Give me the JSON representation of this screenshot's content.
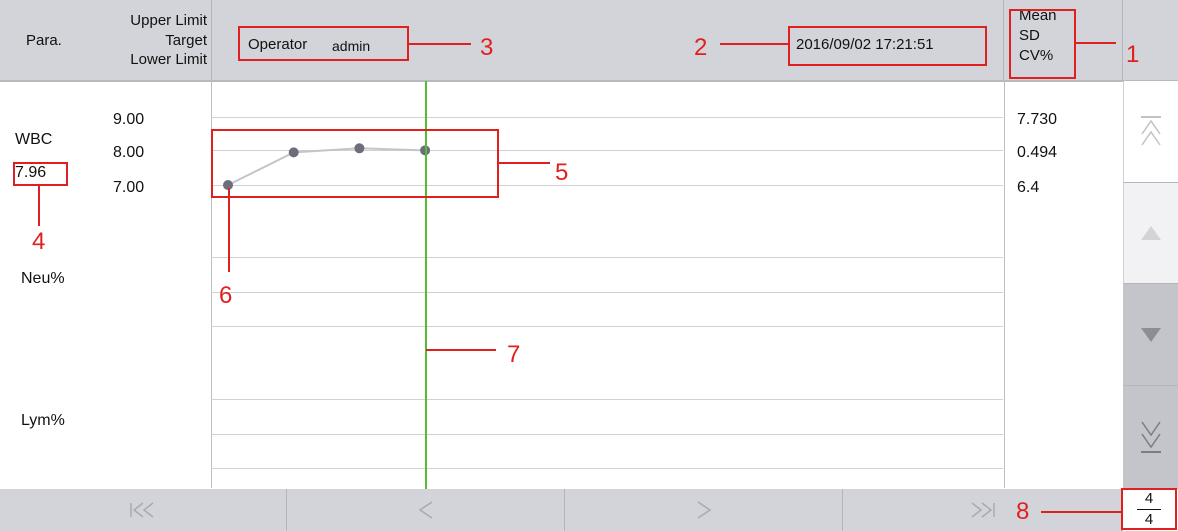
{
  "header": {
    "para_label": "Para.",
    "upper_limit": "Upper Limit",
    "target": "Target",
    "lower_limit": "Lower Limit",
    "operator_label": "Operator",
    "operator_value": "admin",
    "datetime": "2016/09/02 17:21:51",
    "mean": "Mean",
    "sd": "SD",
    "cv": "CV%"
  },
  "params": [
    {
      "name": "WBC",
      "value": "7.96",
      "upper": "9.00",
      "target": "8.00",
      "lower": "7.00",
      "mean": "7.730",
      "sd": "0.494",
      "cv": "6.4"
    },
    {
      "name": "Neu%"
    },
    {
      "name": "Lym%"
    }
  ],
  "page": {
    "current": "4",
    "total": "4"
  },
  "callouts": {
    "c1": "1",
    "c2": "2",
    "c3": "3",
    "c4": "4",
    "c5": "5",
    "c6": "6",
    "c7": "7",
    "c8": "8"
  },
  "colors": {
    "header_bg": "#d3d4d9",
    "marker_line": "#55bb33",
    "callout": "#e02020",
    "point": "#6d6e7a"
  },
  "chart_data": {
    "type": "line",
    "title": "",
    "series": [
      {
        "values": [
          7.0,
          7.96,
          8.08,
          8.02
        ]
      }
    ],
    "x": [
      1,
      2,
      3,
      4
    ],
    "ylim": [
      7.0,
      9.0
    ],
    "grid": true
  },
  "icons": {
    "scroll_top": "double-up-arrow-icon",
    "scroll_up": "up-arrow-icon",
    "scroll_down": "down-arrow-icon",
    "scroll_bottom": "double-down-arrow-icon",
    "first": "first-page-icon",
    "prev": "prev-icon",
    "next": "next-icon",
    "last": "last-page-icon"
  }
}
